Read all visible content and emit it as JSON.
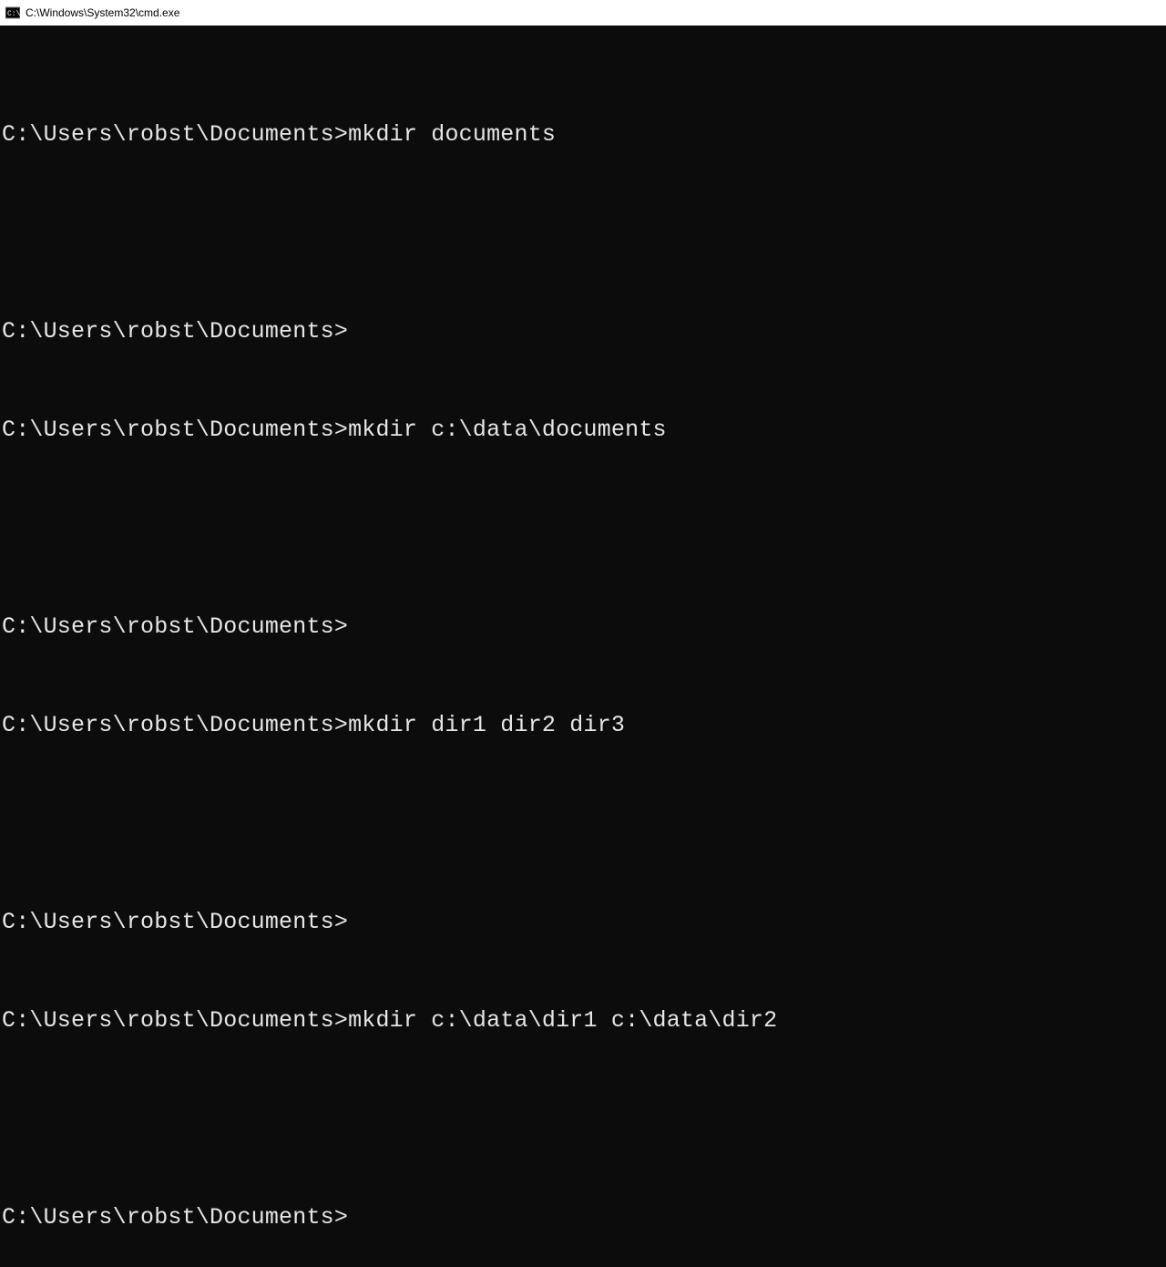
{
  "titlebar": {
    "title": "C:\\Windows\\System32\\cmd.exe"
  },
  "terminal": {
    "prompt": "C:\\Users\\robst\\Documents>",
    "lines": [
      {
        "prompt": "C:\\Users\\robst\\Documents>",
        "command": "mkdir documents"
      },
      {
        "blank": true
      },
      {
        "prompt": "C:\\Users\\robst\\Documents>",
        "command": ""
      },
      {
        "prompt": "C:\\Users\\robst\\Documents>",
        "command": "mkdir c:\\data\\documents"
      },
      {
        "blank": true
      },
      {
        "prompt": "C:\\Users\\robst\\Documents>",
        "command": ""
      },
      {
        "prompt": "C:\\Users\\robst\\Documents>",
        "command": "mkdir dir1 dir2 dir3"
      },
      {
        "blank": true
      },
      {
        "prompt": "C:\\Users\\robst\\Documents>",
        "command": ""
      },
      {
        "prompt": "C:\\Users\\robst\\Documents>",
        "command": "mkdir c:\\data\\dir1 c:\\data\\dir2"
      },
      {
        "blank": true
      },
      {
        "prompt": "C:\\Users\\robst\\Documents>",
        "command": ""
      }
    ]
  }
}
